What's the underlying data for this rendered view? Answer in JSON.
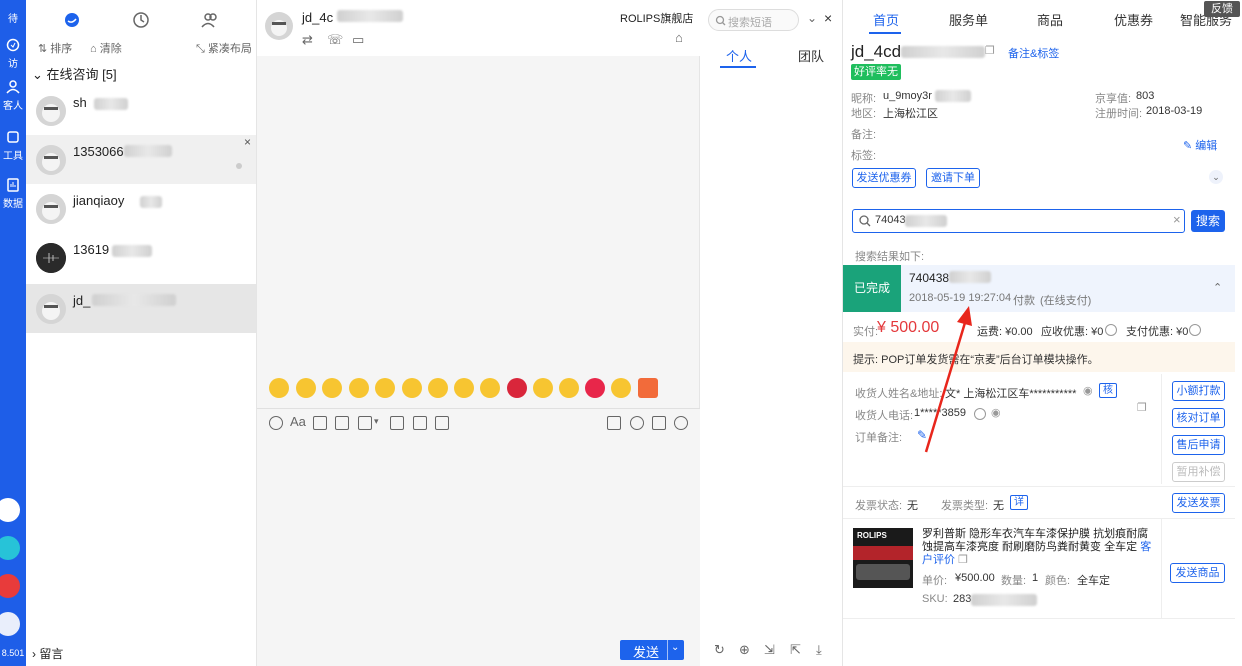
{
  "rail": {
    "items": [
      "待",
      "访",
      "客人",
      "工具",
      "数据"
    ],
    "version": "8.501"
  },
  "convlist": {
    "toolbar": {
      "sort": "排序",
      "clear": "清除",
      "compact": "紧凑布局"
    },
    "group_label": "在线咨询 [5]",
    "conversations": [
      {
        "name": "sh"
      },
      {
        "name": "1353066"
      },
      {
        "name": "jianqiaoy"
      },
      {
        "name": "13619"
      },
      {
        "name": "jd_"
      }
    ],
    "footer": "留言"
  },
  "chat": {
    "contact_name": "jd_4c",
    "shop_name": "ROLIPS旗舰店",
    "send_label": "发送"
  },
  "phrases": {
    "search_placeholder": "搜索短语",
    "tab_personal": "个人",
    "tab_team": "团队"
  },
  "panel": {
    "tabs": [
      "首页",
      "服务单",
      "商品",
      "优惠券",
      "智能服务"
    ],
    "feedback": "反馈",
    "customer": {
      "id": "jd_4cd",
      "remark_link": "备注&标签",
      "badge": "好评率无",
      "nickname_label": "昵称:",
      "nickname": "u_9moy3r",
      "region_label": "地区:",
      "region": "上海松江区",
      "jingxiang_label": "京享值:",
      "jingxiang": "803",
      "regtime_label": "注册时间:",
      "regtime": "2018-03-19",
      "note_label": "备注:",
      "tag_label": "标签:",
      "edit": "编辑",
      "btn_coupon": "发送优惠券",
      "btn_invite": "邀请下单"
    },
    "search": {
      "value": "74043",
      "button": "搜索",
      "result_label": "搜索结果如下:"
    },
    "order": {
      "status": "已完成",
      "id": "740438",
      "time": "2018-05-19 19:27:04",
      "pay_label": "付款",
      "pay_method": "(在线支付)",
      "paid_label": "实付:",
      "paid": "¥ 500.00",
      "shipping": "运费: ¥0.00",
      "discount": "应收优惠: ¥0",
      "pay_discount": "支付优惠: ¥0",
      "tip": "提示: POP订单发货需在“京麦”后台订单模块操作。",
      "receiver_label": "收货人姓名&地址:",
      "receiver": "文* 上海松江区车***********",
      "verify": "核",
      "phone_label": "收货人电话:",
      "phone": "1*****3859",
      "order_note_label": "订单备注:",
      "btn_small_pay": "小额打款",
      "btn_check": "核对订单",
      "btn_aftersale": "售后申请",
      "btn_compensate": "暂用补偿",
      "invoice_status_label": "发票状态:",
      "invoice_status": "无",
      "invoice_type_label": "发票类型:",
      "invoice_type": "无",
      "invoice_detail": "详",
      "btn_invoice": "发送发票"
    },
    "product": {
      "brand_logo": "ROLIPS",
      "title": "罗利普斯 隐形车衣汽车车漆保护膜 抗划痕耐腐蚀提高车漆亮度 耐刷磨防鸟粪耐黄变 全车定",
      "review_link": "客户评价",
      "price_label": "单价:",
      "price": "¥500.00",
      "qty_label": "数量:",
      "qty": "1",
      "color_label": "颜色:",
      "color": "全车定",
      "sku_label": "SKU:",
      "sku": "283",
      "btn_send": "发送商品"
    }
  },
  "colors": {
    "brand_blue": "#1d63ec",
    "status_green": "#1aa37a",
    "price_red": "#e4393c",
    "arrow_red": "#e8261c"
  }
}
